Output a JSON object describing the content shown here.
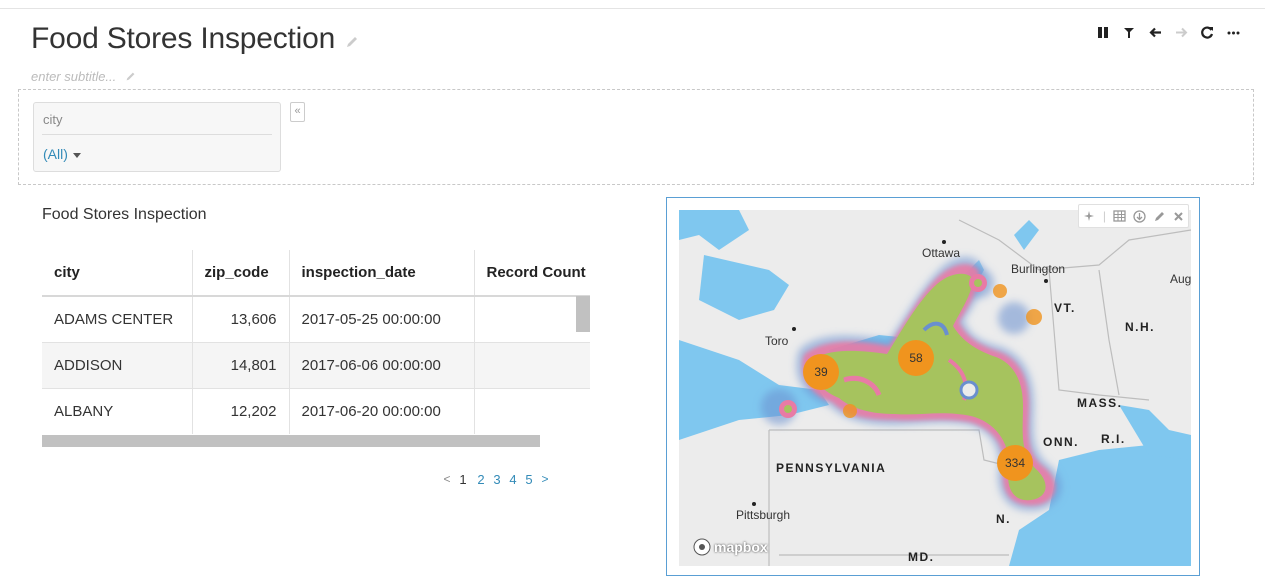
{
  "dashboard": {
    "title": "Food Stores Inspection",
    "subtitle_placeholder": "enter subtitle..."
  },
  "toolbar": {
    "items": [
      "pause",
      "filter",
      "back",
      "forward",
      "refresh",
      "more"
    ]
  },
  "filter": {
    "label": "city",
    "value": "(All)",
    "collapse_glyph": "«"
  },
  "table": {
    "title": "Food Stores Inspection",
    "columns": [
      "city",
      "zip_code",
      "inspection_date",
      "Record Count"
    ],
    "rows": [
      [
        "ADAMS CENTER",
        "13,606",
        "2017-05-25 00:00:00",
        ""
      ],
      [
        "ADDISON",
        "14,801",
        "2017-06-06 00:00:00",
        ""
      ],
      [
        "ALBANY",
        "12,202",
        "2017-06-20 00:00:00",
        ""
      ]
    ],
    "pagination": {
      "prev": "<",
      "pages": [
        "1",
        "2",
        "3",
        "4",
        "5"
      ],
      "current": "1",
      "next": ">"
    }
  },
  "map": {
    "labels": {
      "ottawa": "Ottawa",
      "burlington": "Burlington",
      "augusta": "Aug",
      "toronto": "Toro",
      "vt": "VT.",
      "nh": "N.H.",
      "mass": "MASS.",
      "conn": "ONN.",
      "ri": "R.I.",
      "pennsylvania": "PENNSYLVANIA",
      "pittsburgh": "Pittsburgh",
      "nj": "N.",
      "md": "MD."
    },
    "clusters": [
      {
        "count": "39"
      },
      {
        "count": "58"
      },
      {
        "count": "334"
      }
    ],
    "attribution": "mapbox",
    "colors": {
      "water": "#7fc7ef",
      "land": "#ececec",
      "cluster": "#f0941e",
      "heat_green": "#a6c35e",
      "heat_pink": "#e87ba5",
      "heat_blue": "#6a8fcf"
    }
  }
}
